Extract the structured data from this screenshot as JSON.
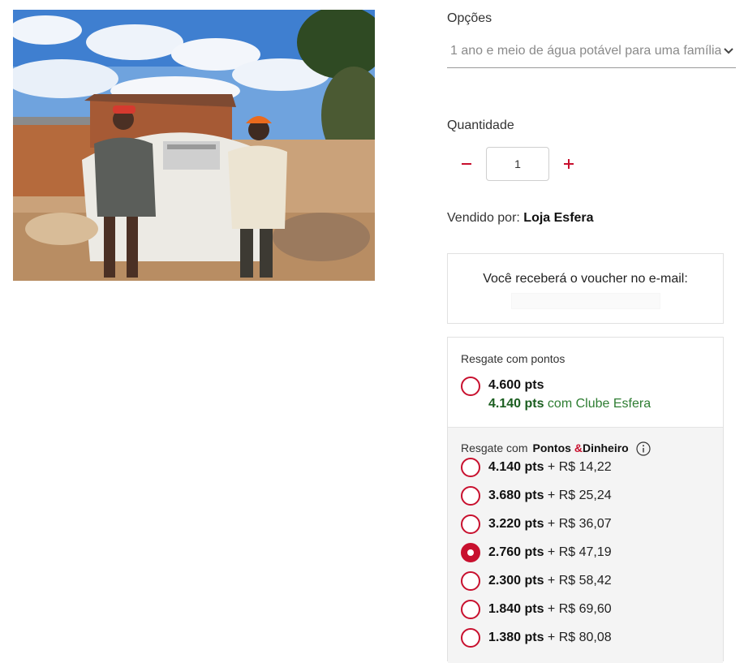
{
  "options": {
    "label": "Opções",
    "selected_value": "1 ano e meio de água potável para uma família"
  },
  "quantity": {
    "label": "Quantidade",
    "value": "1",
    "minus_symbol": "−",
    "plus_symbol": "+"
  },
  "seller": {
    "prefix": "Vendido por: ",
    "name": "Loja Esfera"
  },
  "voucher": {
    "text": "Você receberá o voucher no e-mail:"
  },
  "redeem_points": {
    "title": "Resgate com pontos",
    "points": "4.600 pts",
    "club_points": "4.140 pts",
    "club_suffix": " com Clube Esfera"
  },
  "redeem_mixed": {
    "title_prefix": "Resgate com",
    "title_brand_a": "Pontos ",
    "title_amp": "&",
    "title_brand_b": "Dinheiro",
    "options": [
      {
        "points": "4.140 pts",
        "money": " + R$ 14,22",
        "selected": false
      },
      {
        "points": "3.680 pts",
        "money": " + R$ 25,24",
        "selected": false
      },
      {
        "points": "3.220 pts",
        "money": " + R$ 36,07",
        "selected": false
      },
      {
        "points": "2.760 pts",
        "money": " + R$ 47,19",
        "selected": true
      },
      {
        "points": "2.300 pts",
        "money": " + R$ 58,42",
        "selected": false
      },
      {
        "points": "1.840 pts",
        "money": " + R$ 69,60",
        "selected": false
      },
      {
        "points": "1.380 pts",
        "money": " + R$ 80,08",
        "selected": false
      }
    ]
  },
  "colors": {
    "accent_red": "#c8102e",
    "club_green": "#2e7d32"
  },
  "icons": {
    "caret": "chevron-down-icon",
    "info": "info-icon",
    "minus": "minus-icon",
    "plus": "plus-icon"
  }
}
